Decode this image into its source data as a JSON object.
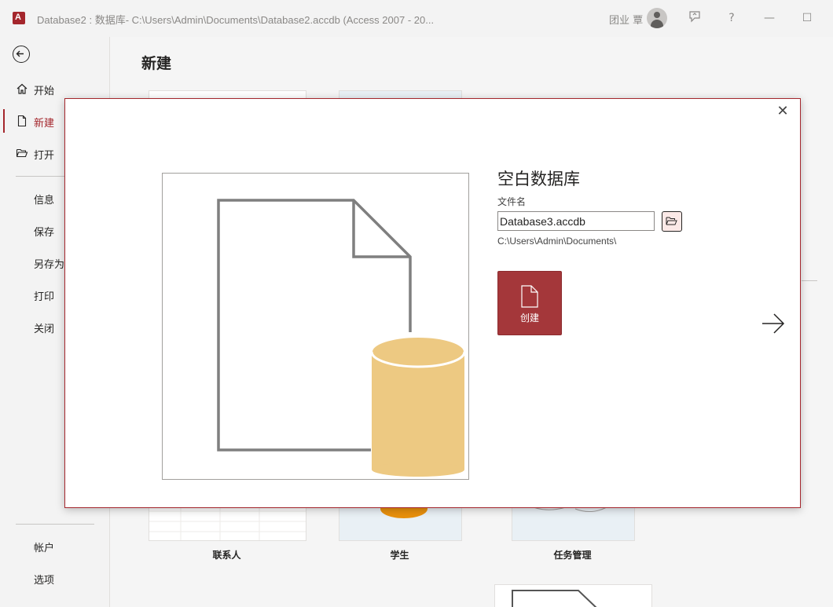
{
  "titlebar": {
    "app_icon_letter": "A",
    "title": "Database2 : 数据库- C:\\Users\\Admin\\Documents\\Database2.accdb (Access 2007 - 20...",
    "user": "团业 覃",
    "buttons": [
      "feedback-icon",
      "help-icon",
      "minimize-icon",
      "maximize-icon"
    ],
    "help_glyph": "?",
    "minimize_glyph": "—",
    "maximize_glyph": "☐"
  },
  "sidebar": {
    "items": [
      {
        "label": "开始",
        "icon": "home-icon"
      },
      {
        "label": "新建",
        "icon": "new-file-icon",
        "active": true
      },
      {
        "label": "打开",
        "icon": "folder-open-icon"
      },
      {
        "label": "信息"
      },
      {
        "label": "保存"
      },
      {
        "label": "另存为"
      },
      {
        "label": "打印"
      },
      {
        "label": "关闭"
      },
      {
        "label": "帐户"
      },
      {
        "label": "选项"
      }
    ]
  },
  "main": {
    "title": "新建",
    "templates": [
      {
        "label": "联系人"
      },
      {
        "label": "学生"
      },
      {
        "label": "任务管理"
      }
    ]
  },
  "dialog": {
    "title": "空白数据库",
    "file_name_label": "文件名",
    "file_name_value": "Database3.accdb",
    "path": "C:\\Users\\Admin\\Documents\\",
    "create_label": "创建",
    "close_glyph": "✕"
  },
  "colors": {
    "accent": "#a4262c",
    "create_button": "#a4373a",
    "database_cylinder": "#edc982"
  }
}
